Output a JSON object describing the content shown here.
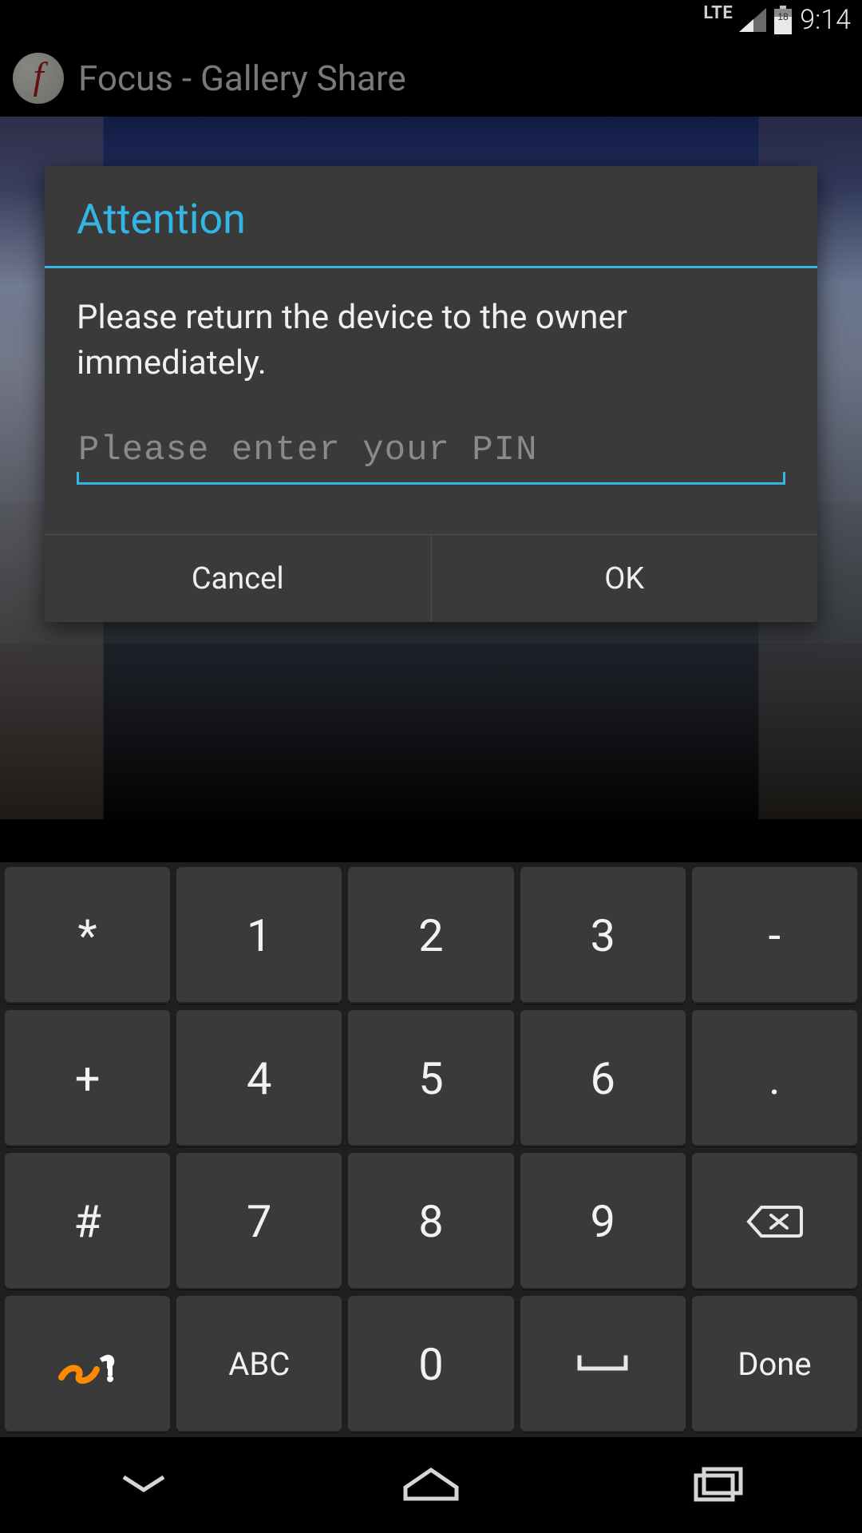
{
  "status": {
    "network": "LTE",
    "battery_level": "18",
    "time": "9:14"
  },
  "app": {
    "title": "Focus - Gallery Share",
    "icon_glyph": "f"
  },
  "dialog": {
    "title": "Attention",
    "message": "Please return the device to the owner immediately.",
    "pin_placeholder": "Please enter your PIN",
    "buttons": {
      "cancel": "Cancel",
      "ok": "OK"
    },
    "colors": {
      "accent": "#33b5e5"
    }
  },
  "keyboard": {
    "rows": [
      [
        "*",
        "1",
        "2",
        "3",
        "-"
      ],
      [
        "+",
        "4",
        "5",
        "6",
        "."
      ],
      [
        "#",
        "7",
        "8",
        "9",
        "backspace"
      ],
      [
        "swype",
        "ABC",
        "0",
        "space",
        "Done"
      ]
    ],
    "special_icons": {
      "backspace": "backspace-icon",
      "swype": "swype-icon",
      "space": "space-icon"
    }
  },
  "navbar": {
    "buttons": [
      "back",
      "home",
      "recents"
    ]
  }
}
